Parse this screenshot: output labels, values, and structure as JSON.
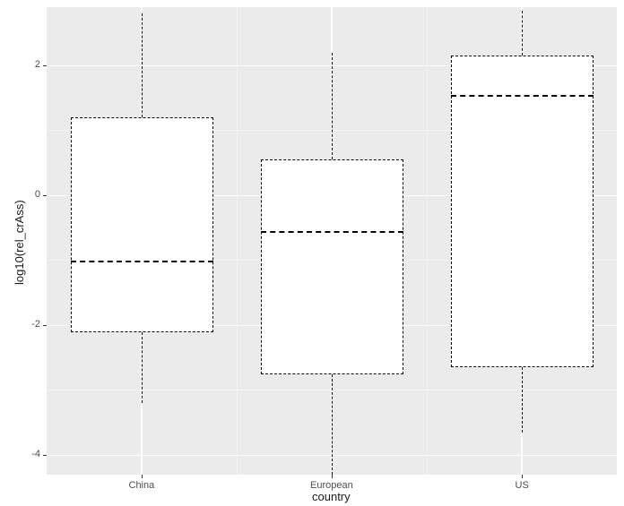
{
  "chart_data": {
    "type": "boxplot",
    "title": "",
    "xlabel": "country",
    "ylabel": "log10(rel_crAss)",
    "categories": [
      "China",
      "European",
      "US"
    ],
    "ylim": [
      -4.3,
      2.9
    ],
    "y_ticks": [
      -4,
      -2,
      0,
      2
    ],
    "series": [
      {
        "name": "China",
        "lower_whisker": -3.2,
        "q1": -2.1,
        "median": -1.0,
        "q3": 1.2,
        "upper_whisker": 2.8
      },
      {
        "name": "European",
        "lower_whisker": -4.3,
        "q1": -2.75,
        "median": -0.55,
        "q3": 0.55,
        "upper_whisker": 2.2
      },
      {
        "name": "US",
        "lower_whisker": -3.65,
        "q1": -2.65,
        "median": 1.55,
        "q3": 2.15,
        "upper_whisker": 2.85
      }
    ]
  },
  "axis": {
    "x_title": "country",
    "y_title": "log10(rel_crAss)",
    "y_tick_labels": [
      "-4",
      "-2",
      "0",
      "2"
    ],
    "x_tick_labels": [
      "China",
      "European",
      "US"
    ]
  }
}
